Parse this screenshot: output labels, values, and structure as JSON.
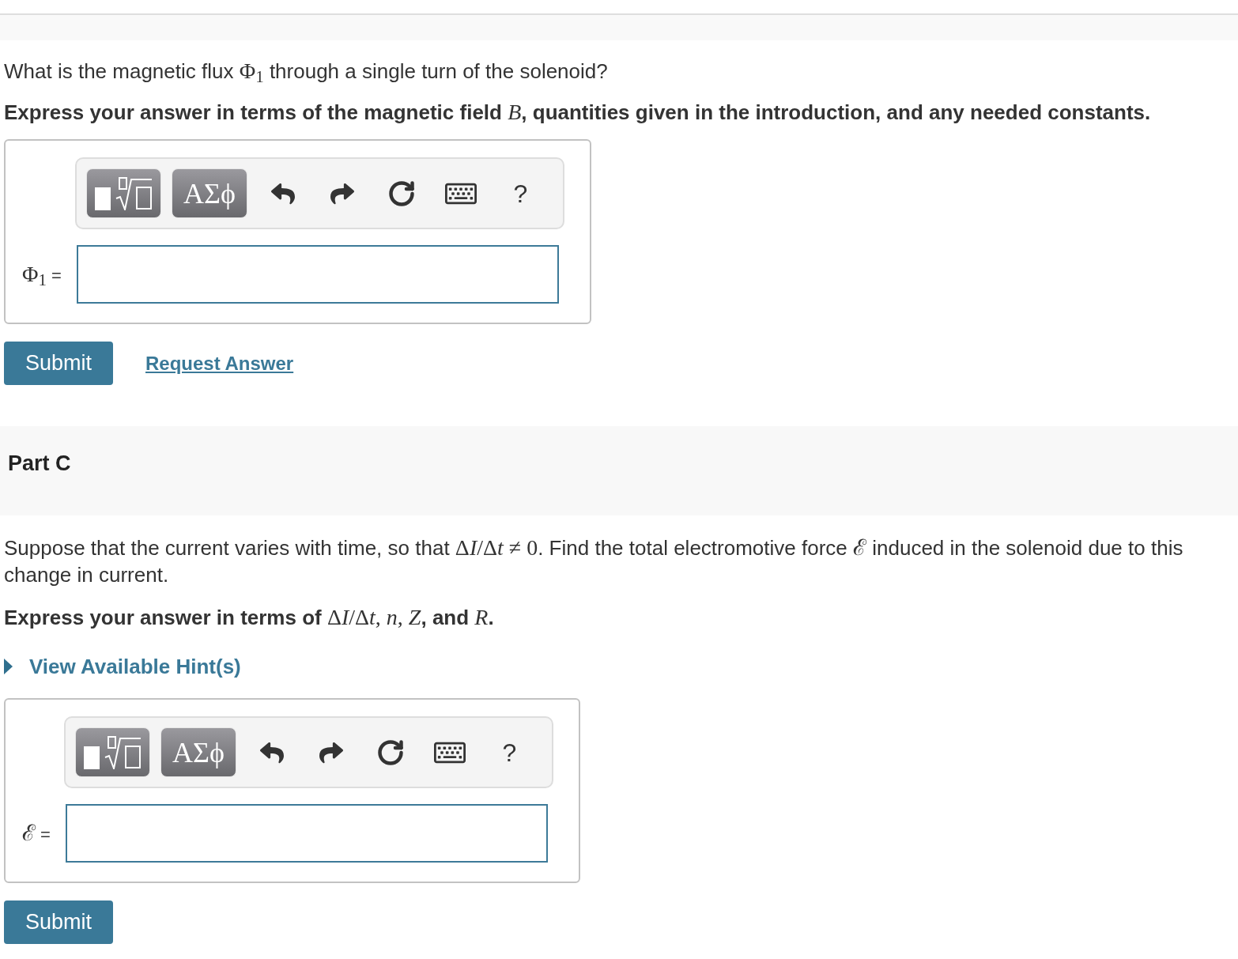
{
  "parts": [
    {
      "question": [
        {
          "kind": "text",
          "text": "What is the magnetic flux "
        },
        {
          "kind": "math",
          "text": "Φ$_{1}$"
        },
        {
          "kind": "text",
          "text": " through a single turn of the solenoid?"
        }
      ],
      "instruction": [
        {
          "kind": "text",
          "text": "Express your answer in terms of the magnetic field "
        },
        {
          "kind": "var",
          "text": "B"
        },
        {
          "kind": "text",
          "text": ", quantities given in the introduction, and any needed constants."
        }
      ],
      "answer": {
        "toolbar": [
          {
            "kind": "templates"
          },
          {
            "kind": "symbols",
            "label": "ΑΣϕ"
          },
          {
            "kind": "undo"
          },
          {
            "kind": "redo"
          },
          {
            "kind": "reset"
          },
          {
            "kind": "keyboard"
          },
          {
            "kind": "help",
            "label": "?"
          }
        ],
        "label": [
          {
            "kind": "math",
            "text": "Φ$_{1}$"
          },
          {
            "kind": "text",
            "text": " ="
          }
        ]
      },
      "actions": {
        "submit": "Submit",
        "request_answer": "Request Answer"
      }
    },
    {
      "title": "Part C",
      "question": [
        {
          "kind": "text",
          "text": "Suppose that the current varies with time, so that "
        },
        {
          "kind": "math",
          "text": "Δ"
        },
        {
          "kind": "var",
          "text": "I"
        },
        {
          "kind": "math",
          "text": "/Δ"
        },
        {
          "kind": "var",
          "text": "t"
        },
        {
          "kind": "math",
          "text": " ≠ 0"
        },
        {
          "kind": "text",
          "text": ". Find the total electromotive force "
        },
        {
          "kind": "math",
          "text": "ℰ"
        },
        {
          "kind": "text",
          "text": " induced in the solenoid due to this change in current."
        }
      ],
      "instruction": [
        {
          "kind": "text",
          "text": "Express your answer in terms of "
        },
        {
          "kind": "math",
          "text": "Δ"
        },
        {
          "kind": "var",
          "text": "I"
        },
        {
          "kind": "math",
          "text": "/Δ"
        },
        {
          "kind": "var",
          "text": "t"
        },
        {
          "kind": "math",
          "text": ", "
        },
        {
          "kind": "var",
          "text": "n"
        },
        {
          "kind": "math",
          "text": ", "
        },
        {
          "kind": "var",
          "text": "Z"
        },
        {
          "kind": "text",
          "text": ", and "
        },
        {
          "kind": "var",
          "text": "R"
        },
        {
          "kind": "text",
          "text": "."
        }
      ],
      "hints": {
        "label": "View Available Hint(s)",
        "expanded": false
      },
      "answer": {
        "toolbar": [
          {
            "kind": "templates"
          },
          {
            "kind": "symbols",
            "label": "ΑΣϕ"
          },
          {
            "kind": "undo"
          },
          {
            "kind": "redo"
          },
          {
            "kind": "reset"
          },
          {
            "kind": "keyboard"
          },
          {
            "kind": "help",
            "label": "?"
          }
        ],
        "label": [
          {
            "kind": "math",
            "text": "ℰ"
          },
          {
            "kind": "text",
            "text": " ="
          }
        ]
      },
      "actions": {
        "submit": "Submit"
      }
    }
  ]
}
